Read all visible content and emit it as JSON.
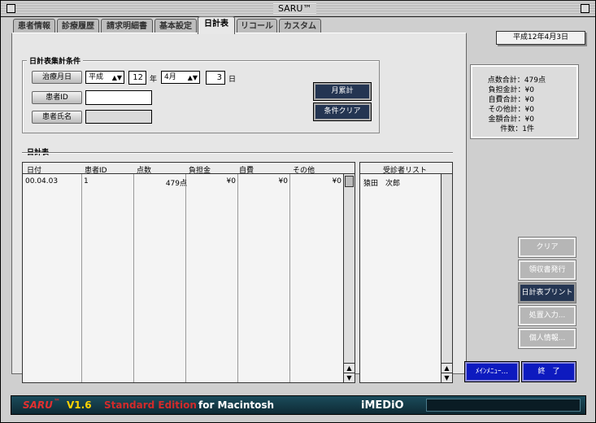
{
  "window": {
    "title": "SARU™"
  },
  "tabs": [
    {
      "label": "患者情報",
      "active": false
    },
    {
      "label": "診療履歴",
      "active": false
    },
    {
      "label": "請求明細書",
      "active": false
    },
    {
      "label": "基本設定",
      "active": false
    },
    {
      "label": "日計表",
      "active": true
    },
    {
      "label": "リコール",
      "active": false
    },
    {
      "label": "カスタム",
      "active": false
    }
  ],
  "header": {
    "date_button": "平成12年4月3日"
  },
  "criteria": {
    "group_label": "日計表集計条件",
    "treatment_date_button": "治療月日",
    "era_select": "平成",
    "year_value": "12",
    "year_unit": "年",
    "month_select": "4月",
    "day_value": "3",
    "day_unit": "日",
    "patient_id_button": "患者ID",
    "patient_id_value": "",
    "patient_name_button": "患者氏名",
    "patient_name_value": "",
    "monthly_total_button": "月累計",
    "clear_conditions_button": "条件クリア"
  },
  "daily": {
    "section_label": "日計表",
    "columns": [
      "日付",
      "患者ID",
      "点数",
      "負担金",
      "自費",
      "その他"
    ],
    "rows": [
      [
        "00.04.03",
        "1",
        "479点",
        "¥0",
        "¥0",
        "¥0"
      ]
    ]
  },
  "patients": {
    "header": "受診者リスト",
    "items": [
      "猿田　次郎"
    ]
  },
  "summary": {
    "lines": [
      {
        "label": "点数合計",
        "value": "479点"
      },
      {
        "label": "負担金計",
        "value": "¥0"
      },
      {
        "label": "自費合計",
        "value": "¥0"
      },
      {
        "label": "その他計",
        "value": "¥0"
      },
      {
        "label": "金額合計",
        "value": "¥0"
      },
      {
        "label": "件数",
        "value": "1件"
      }
    ]
  },
  "actions": {
    "clear": "クリア",
    "receipt": "領収書発行",
    "print": "日計表プリント",
    "procedure": "処置入力...",
    "personal": "個人情報..."
  },
  "bottom": {
    "main_menu": "ﾒｲﾝﾒﾆｭｰ...",
    "quit": "終　了"
  },
  "footer": {
    "product": "SARU",
    "tm": "™",
    "version": "V1.6",
    "edition": "Standard Edition",
    "platform": "for Macintosh",
    "brand": "iMEDiO"
  },
  "colors": {
    "accent_dark": "#243552",
    "blue_button": "#0d1abf",
    "footer_bg": "#1b4c5c",
    "edition_text": "#d22b2b"
  }
}
